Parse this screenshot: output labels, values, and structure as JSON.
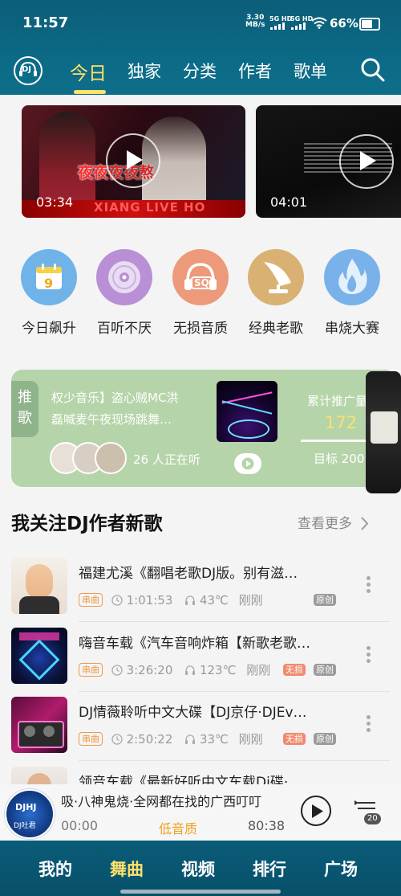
{
  "status_bar": {
    "time": "11:57",
    "net_speed_value": "3.30",
    "net_speed_unit": "MB/s",
    "sim1": "5G HD",
    "sim2": "5G HD",
    "battery": "66%"
  },
  "header": {
    "logo_text": "DJ",
    "tabs": [
      "今日",
      "独家",
      "分类",
      "作者",
      "歌单"
    ],
    "active_tab": "今日"
  },
  "videos": [
    {
      "duration": "03:34",
      "overlay_text": "夜夜夜夜熬",
      "bottom_text": "XIANG LIVE HO"
    },
    {
      "duration": "04:01"
    }
  ],
  "categories": [
    {
      "label": "今日飙升",
      "icon": "calendar-icon",
      "icon_text": "9",
      "color": "#6fb3e8"
    },
    {
      "label": "百听不厌",
      "icon": "disc-icon",
      "icon_text": "",
      "color": "#b990d6"
    },
    {
      "label": "无损音质",
      "icon": "headphones-sq-icon",
      "icon_text": "SQ",
      "color": "#ec9a7a"
    },
    {
      "label": "经典老歌",
      "icon": "gramophone-icon",
      "icon_text": "",
      "color": "#d9b172"
    },
    {
      "label": "串烧大赛",
      "icon": "flame-icon",
      "icon_text": "",
      "color": "#79b1ea"
    }
  ],
  "push_card": {
    "badge_line1": "推",
    "badge_line2": "歌",
    "title_line1": "权少音乐】盗心贼MC洪",
    "title_line2": "磊喊麦午夜现场跳舞…",
    "listening": "26 人正在听",
    "total_label": "累计推广量",
    "total_value": "172",
    "goal_label": "目标 200"
  },
  "section": {
    "title": "我关注DJ作者新歌",
    "more": "查看更多"
  },
  "songs": [
    {
      "title": "福建尤溪《翻唱老歌DJ版。别有滋…",
      "tag": "串曲",
      "duration": "1:01:53",
      "heat": "43℃",
      "time": "刚刚",
      "lossless": "",
      "original": "原创"
    },
    {
      "title": "嗨音车载《汽车音响炸箱【新歌老歌…",
      "tag": "串曲",
      "duration": "3:26:20",
      "heat": "123℃",
      "time": "刚刚",
      "lossless": "无损",
      "original": "原创"
    },
    {
      "title": "DJ情薇聆听中文大碟【DJ京仔·DJEv…",
      "tag": "串曲",
      "duration": "2:50:22",
      "heat": "33℃",
      "time": "刚刚",
      "lossless": "无损",
      "original": "原创"
    },
    {
      "title": "领音车载《最新好听中文车载Dj碟·…",
      "tag": "",
      "duration": "",
      "heat": "",
      "time": "",
      "lossless": "",
      "original": ""
    }
  ],
  "player": {
    "cover_text": "DJHJ",
    "cover_subtext": "DJ吐君",
    "title": "吸·八神鬼烧·全网都在找的广西叮叮",
    "current_time": "00:00",
    "quality": "低音质",
    "total_time": "80:38",
    "queue_count": "20"
  },
  "bottom_nav": [
    "我的",
    "舞曲",
    "视频",
    "排行",
    "广场"
  ],
  "bottom_nav_active": "舞曲"
}
